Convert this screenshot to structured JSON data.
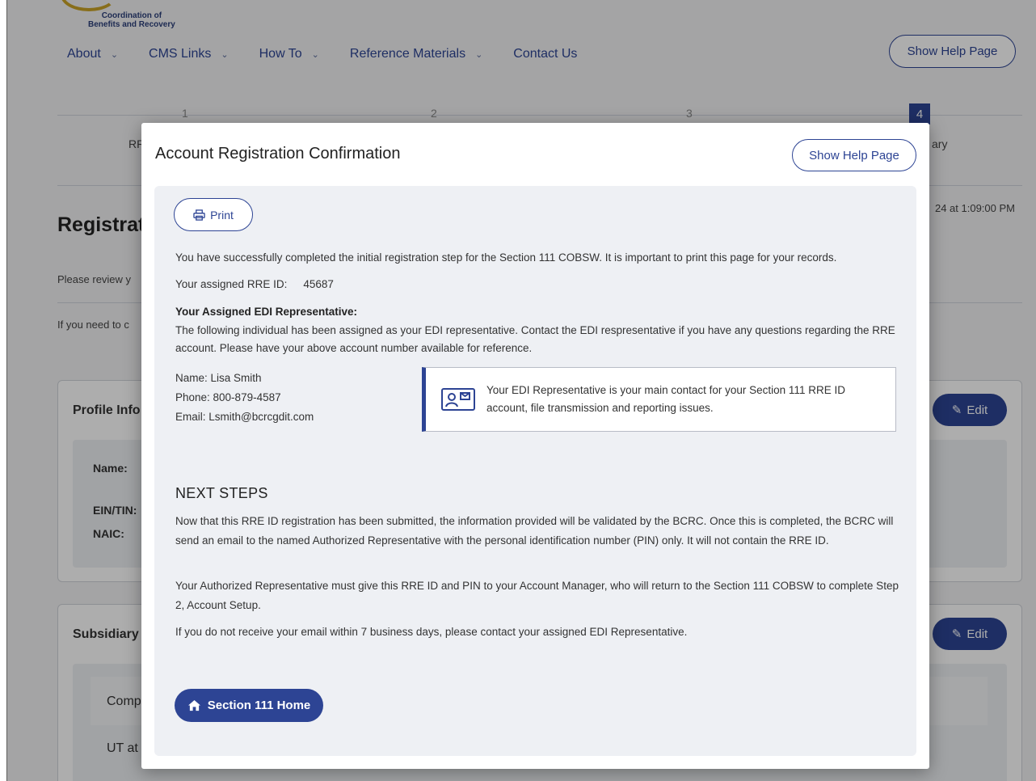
{
  "background": {
    "logo_line1": "Coordination of",
    "logo_line2": "Benefits and Recovery",
    "nav": [
      {
        "label": "About"
      },
      {
        "label": "CMS Links"
      },
      {
        "label": "How To"
      },
      {
        "label": "Reference Materials"
      },
      {
        "label": "Contact Us"
      }
    ],
    "help_button": "Show Help Page",
    "steps": [
      "1",
      "2",
      "3",
      "4"
    ],
    "step_label_left": "RRI",
    "step_label_right": "ary",
    "timestamp": "24 at 1:09:00 PM",
    "heading": "Registrat",
    "para1": "Please review y",
    "para2": "If you need to c",
    "profile_card": {
      "title": "Profile Info",
      "fields": [
        "Name:",
        "EIN/TIN:",
        "NAIC:"
      ],
      "edit_label": "Edit"
    },
    "subsidiary_card": {
      "title": "Subsidiary",
      "row1": "Comp",
      "row2": "UT at",
      "edit_label": "Edit"
    }
  },
  "modal": {
    "title": "Account Registration Confirmation",
    "help_button": "Show Help Page",
    "print_button": "Print",
    "intro": "You have successfully completed the initial registration step for the Section 111 COBSW. It is important to print this page for your records.",
    "rre_label": "Your assigned RRE ID:",
    "rre_value": "45687",
    "edi_heading": "Your Assigned EDI Representative:",
    "edi_text": "The following individual has been assigned as your EDI representative. Contact the EDI respresentative if you have any questions regarding the RRE account. Please have your above account number available for reference.",
    "contact": {
      "name": "Name: Lisa Smith",
      "phone": "Phone: 800-879-4587",
      "email": "Email: Lsmith@bcrcgdit.com"
    },
    "callout": "Your EDI Representative is your main contact for your Section 111 RRE ID account, file transmission and reporting issues.",
    "next_steps_title": "NEXT STEPS",
    "next_steps_p1": "Now that this RRE ID registration has been submitted, the information provided will be validated by the BCRC. Once this is completed, the BCRC will send an email to the named Authorized Representative with the personal identification number (PIN) only. It will not contain the RRE ID.",
    "next_steps_p2": "Your Authorized Representative must give this RRE ID and PIN to your Account Manager, who will return to the Section 111 COBSW to complete Step 2, Account Setup.",
    "next_steps_p3": "If you do not receive your email within 7 business days, please contact your assigned EDI Representative.",
    "home_button": "Section 111 Home"
  },
  "colors": {
    "primary": "#2d4494",
    "panel": "#eef0f4",
    "overlay": "rgba(0,0,0,0.32)"
  }
}
